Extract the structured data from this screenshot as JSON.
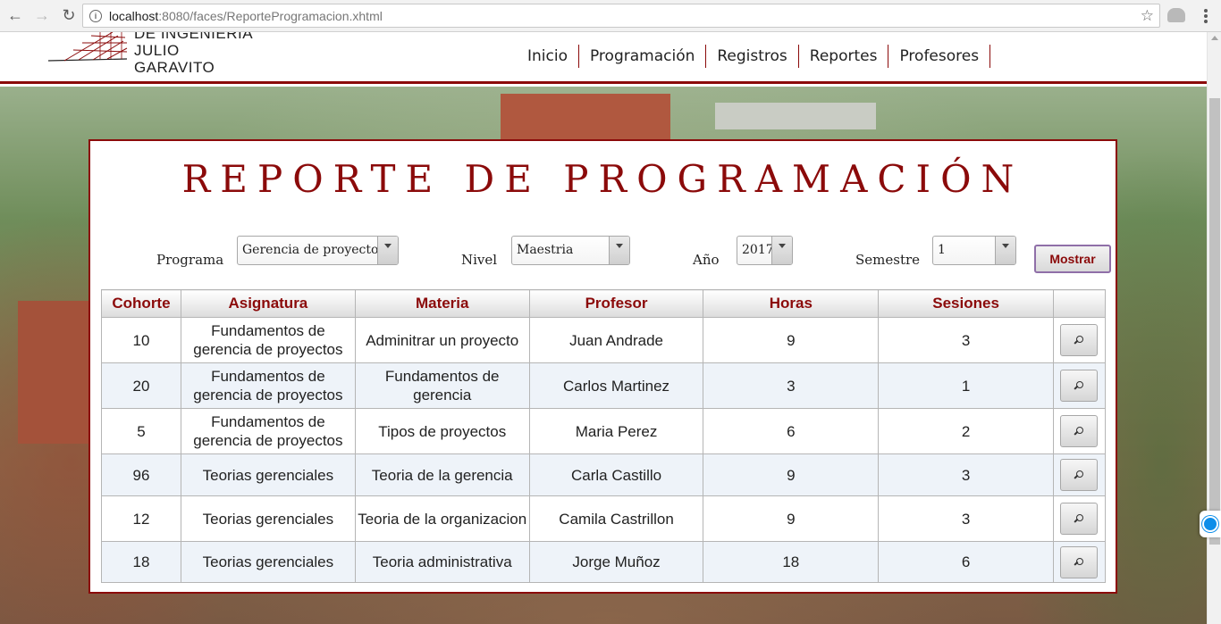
{
  "browser": {
    "url_host": "localhost",
    "url_path": ":8080/faces/ReporteProgramacion.xhtml"
  },
  "header": {
    "logo_line1": "DE INGENIERÍA",
    "logo_line2": "JULIO GARAVITO",
    "nav": [
      "Inicio",
      "Programación",
      "Registros",
      "Reportes",
      "Profesores"
    ]
  },
  "report": {
    "title": "REPORTE DE PROGRAMACIÓN",
    "filters": {
      "programa_label": "Programa",
      "programa_value": "Gerencia de proyectos",
      "nivel_label": "Nivel",
      "nivel_value": "Maestria",
      "anio_label": "Año",
      "anio_value": "2017",
      "semestre_label": "Semestre",
      "semestre_value": "1",
      "mostrar_label": "Mostrar"
    },
    "columns": [
      "Cohorte",
      "Asignatura",
      "Materia",
      "Profesor",
      "Horas",
      "Sesiones",
      ""
    ],
    "rows": [
      {
        "cohorte": "10",
        "asignatura": "Fundamentos de gerencia de proyectos",
        "materia": "Adminitrar un proyecto",
        "profesor": "Juan Andrade",
        "horas": "9",
        "sesiones": "3"
      },
      {
        "cohorte": "20",
        "asignatura": "Fundamentos de gerencia de proyectos",
        "materia": "Fundamentos de gerencia",
        "profesor": "Carlos Martinez",
        "horas": "3",
        "sesiones": "1"
      },
      {
        "cohorte": "5",
        "asignatura": "Fundamentos de gerencia de proyectos",
        "materia": "Tipos de proyectos",
        "profesor": "Maria Perez",
        "horas": "6",
        "sesiones": "2"
      },
      {
        "cohorte": "96",
        "asignatura": "Teorias gerenciales",
        "materia": "Teoria de la gerencia",
        "profesor": "Carla Castillo",
        "horas": "9",
        "sesiones": "3"
      },
      {
        "cohorte": "12",
        "asignatura": "Teorias gerenciales",
        "materia": "Teoria de la organizacion",
        "profesor": "Camila Castrillon",
        "horas": "9",
        "sesiones": "3"
      },
      {
        "cohorte": "18",
        "asignatura": "Teorias gerenciales",
        "materia": "Teoria administrativa",
        "profesor": "Jorge Muñoz",
        "horas": "18",
        "sesiones": "6"
      }
    ],
    "row_action_icon": "search-icon"
  },
  "colors": {
    "brand": "#8b0a0a",
    "row_alt": "#eef3f9"
  }
}
